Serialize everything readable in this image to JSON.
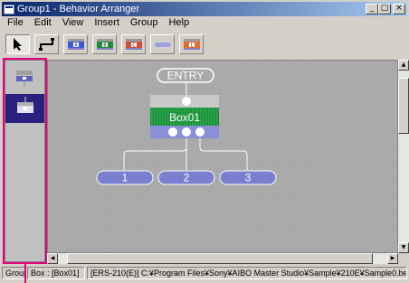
{
  "window": {
    "title": "Group1 - Behavior Arranger",
    "controls": {
      "minimize": "_",
      "maximize": "□",
      "close": "×"
    }
  },
  "menu": [
    "File",
    "Edit",
    "View",
    "Insert",
    "Group",
    "Help"
  ],
  "toolbar": [
    {
      "name": "select-tool",
      "icon": "arrow-cursor-icon"
    },
    {
      "name": "connect-tool",
      "icon": "connector-icon"
    },
    {
      "name": "action-box-tool",
      "icon": "box-a-icon",
      "label": "A"
    },
    {
      "name": "behavior-box-tool",
      "icon": "box-b-icon",
      "label": "B"
    },
    {
      "name": "group-box-tool",
      "icon": "box-c-icon",
      "label": "C"
    },
    {
      "name": "bar-tool",
      "icon": "bar-icon"
    },
    {
      "name": "loop-box-tool",
      "icon": "box-l-icon",
      "label": "L"
    }
  ],
  "graph": {
    "entry_label": "ENTRY",
    "box_label": "Box01",
    "outputs": [
      "1",
      "2",
      "3"
    ]
  },
  "status": {
    "mode": "Group",
    "box_label": "Box : [Box01]",
    "path": "[ERS-210(E)] C:¥Program Files¥Sony¥AIBO Master Studio¥Sample¥210E¥Sample0.be"
  },
  "colors": {
    "titlebar": "#0a246a",
    "highlight": "#e6007e",
    "box_green": "#1e8a3a",
    "out_pill": "#7b7fd0",
    "palette_selected": "#2a2080"
  }
}
